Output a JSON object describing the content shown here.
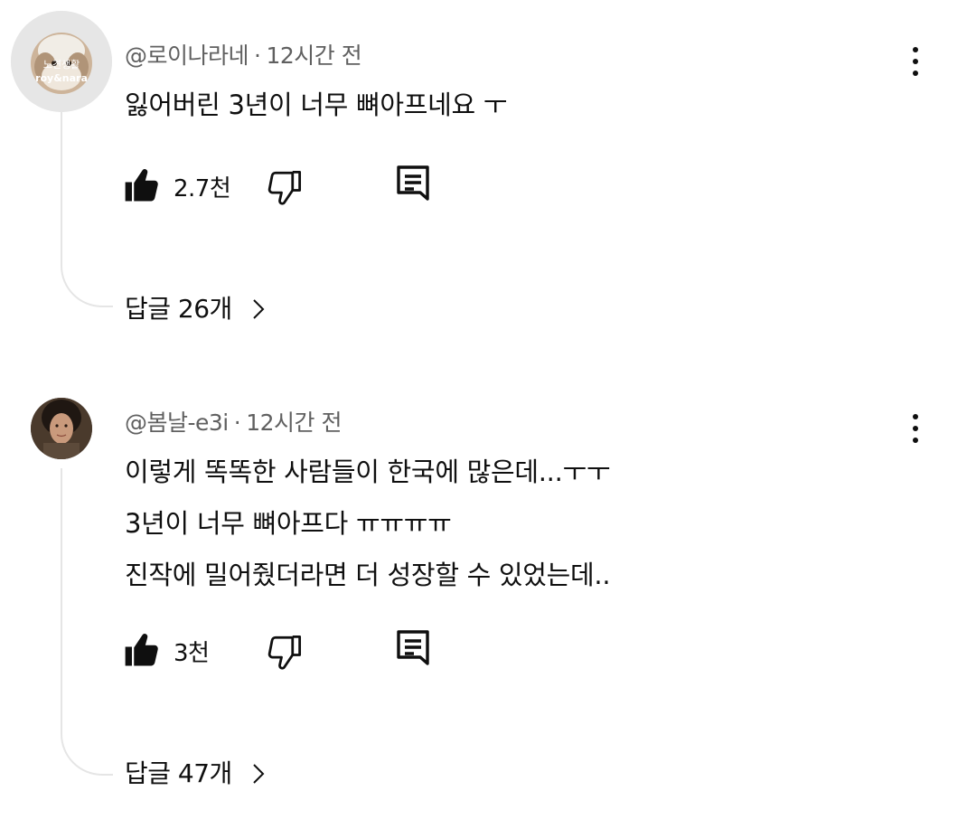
{
  "comments": [
    {
      "author": "@로이나라네",
      "separator": "·",
      "time": "12시간 전",
      "avatar_text": {
        "line1": "노견생활",
        "line2": "roy&nara"
      },
      "lines": [
        "잃어버린 3년이 너무 뼈아프네요 ㅜ"
      ],
      "likes": "2.7천",
      "replies_label": "답글 26개"
    },
    {
      "author": "@봄날-e3i",
      "separator": "·",
      "time": "12시간 전",
      "lines": [
        "이렇게 똑똑한 사람들이 한국에 많은데...ㅜㅜ",
        "3년이 너무 뼈아프다 ㅠㅠㅠㅠ",
        "진작에 밀어줬더라면 더 성장할 수 있었는데.."
      ],
      "likes": "3천",
      "replies_label": "답글 47개"
    }
  ],
  "icons": {
    "like": "thumbs-up-filled-icon",
    "dislike": "thumbs-down-outline-icon",
    "reply": "reply-comment-icon",
    "more": "more-vertical-icon",
    "expand": "chevron-right-icon"
  },
  "colors": {
    "text": "#0f0f0f",
    "meta": "#606060",
    "thread_line": "#e5e5e5",
    "background": "#ffffff"
  }
}
